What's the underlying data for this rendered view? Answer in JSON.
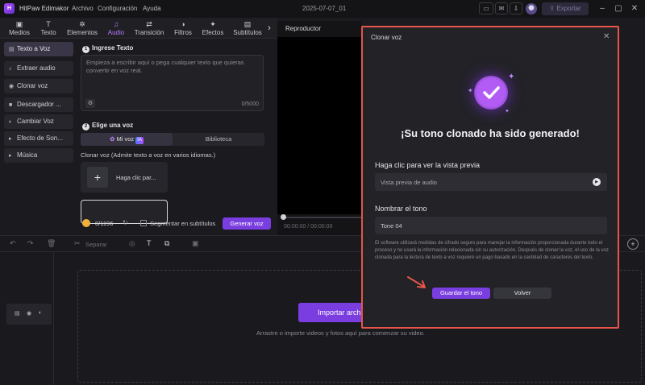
{
  "app": {
    "logo": "H",
    "title": "HitPaw Edimakor",
    "project": "2025-07-07_01",
    "export_label": "Exportar",
    "menus": [
      "Archivo",
      "Configuración",
      "Ayuda"
    ],
    "accent": "#7a3de0"
  },
  "tooltabs": [
    {
      "label": "Medios",
      "icon": "media-icon"
    },
    {
      "label": "Texto",
      "icon": "text-icon"
    },
    {
      "label": "Elementos",
      "icon": "elements-icon"
    },
    {
      "label": "Audio",
      "icon": "audio-icon"
    },
    {
      "label": "Transición",
      "icon": "transition-icon"
    },
    {
      "label": "Filtros",
      "icon": "filters-icon"
    },
    {
      "label": "Efectos",
      "icon": "effects-icon"
    },
    {
      "label": "Subtítulos",
      "icon": "subtitles-icon"
    }
  ],
  "sidebar": {
    "items": [
      "Texto a Voz",
      "Extraer audio",
      "Clonar voz",
      "Descargador ...",
      "Cambiar Voz",
      "Efecto de Son...",
      "Música"
    ]
  },
  "tts": {
    "step1": "Ingrese Texto",
    "step1_num": "1",
    "placeholder": "Empieza a escribir aquí o pega cualquier texto que quieras convertir en voz real.",
    "counter": "0/5000",
    "step2": "Elige una voz",
    "step2_num": "2",
    "tab_mi_voz": "Mi voz",
    "ia_badge": "IA",
    "tab_biblioteca": "Biblioteca",
    "clone_hint": "Clonar voz (Admite texto a voz en varios idiomas.)",
    "clone_card_label": "Haga clic par...",
    "credits": "0/1196",
    "segment_label": "Segmentar en subtítulos",
    "generate_label": "Generar voz"
  },
  "player": {
    "title": "Reproductor",
    "time": "00:00:00 / 00:00:00"
  },
  "timeline": {
    "split_label": "Separar",
    "import_label": "Importar archivos",
    "drop_hint": "Arrastre o importe videos y fotos aquí para comenzar su video."
  },
  "modal": {
    "title": "Clonar voz",
    "heading": "¡Su tono clonado ha sido generado!",
    "preview_title": "Haga clic para ver la vista previa",
    "preview_label": "Vista previa de audio",
    "name_title": "Nombrar el tono",
    "name_value": "Tone 04",
    "disclaimer": "El software utilizará medidas de cifrado seguro para manejar la información proporcionada durante todo el proceso y no usará la información relacionada sin su autorización. Después de clonar la voz, el uso de la voz clonada para la lectura de texto a voz requiere un pago basado en la cantidad de caracteres del texto.",
    "save_label": "Guardar el tono",
    "back_label": "Volver",
    "highlight_color": "#e5554a"
  }
}
